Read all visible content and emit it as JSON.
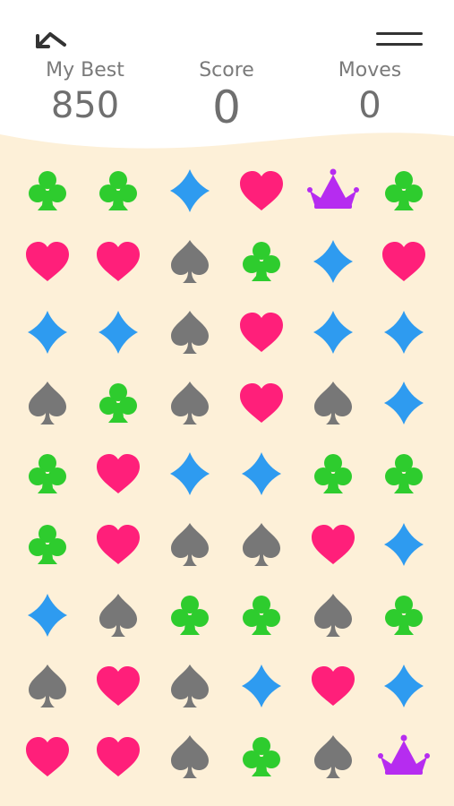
{
  "header": {
    "back_icon": "back-arrow-icon",
    "menu_icon": "menu-icon",
    "stats": {
      "best_label": "My Best",
      "best_value": "850",
      "score_label": "Score",
      "score_value": "0",
      "moves_label": "Moves",
      "moves_value": "0"
    }
  },
  "colors": {
    "club": "#2ecc2e",
    "diamond": "#2e9bf0",
    "heart": "#ff1f7a",
    "spade": "#777777",
    "crown": "#b62cf0",
    "board_background": "#fdf0d8",
    "text": "#777777"
  },
  "board": {
    "rows": [
      [
        "club",
        "club",
        "diamond",
        "heart",
        "crown",
        "club"
      ],
      [
        "heart",
        "heart",
        "spade",
        "club",
        "diamond",
        "heart"
      ],
      [
        "diamond",
        "diamond",
        "spade",
        "heart",
        "diamond",
        "diamond"
      ],
      [
        "spade",
        "club",
        "spade",
        "heart",
        "spade",
        "diamond"
      ],
      [
        "club",
        "heart",
        "diamond",
        "diamond",
        "club",
        "club"
      ],
      [
        "club",
        "heart",
        "spade",
        "spade",
        "heart",
        "diamond"
      ],
      [
        "diamond",
        "spade",
        "club",
        "club",
        "spade",
        "club"
      ],
      [
        "spade",
        "heart",
        "spade",
        "diamond",
        "heart",
        "diamond"
      ],
      [
        "heart",
        "heart",
        "spade",
        "club",
        "spade",
        "crown"
      ]
    ]
  }
}
